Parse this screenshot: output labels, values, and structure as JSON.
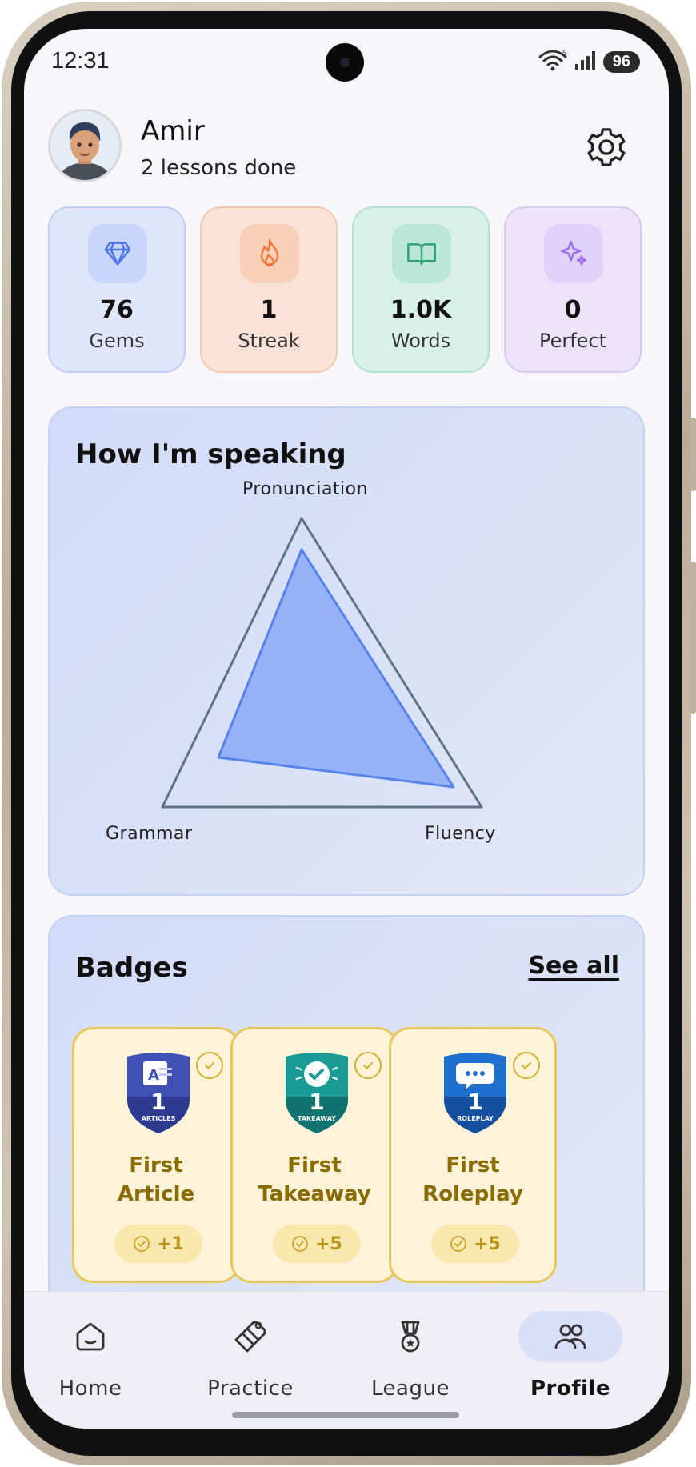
{
  "status_bar": {
    "time": "12:31",
    "battery": "96",
    "network_badge": "5"
  },
  "profile": {
    "name": "Amir",
    "subtitle": "2 lessons done"
  },
  "stats": [
    {
      "value": "76",
      "label": "Gems",
      "icon": "gem-icon"
    },
    {
      "value": "1",
      "label": "Streak",
      "icon": "flame-icon"
    },
    {
      "value": "1.0K",
      "label": "Words",
      "icon": "book-icon"
    },
    {
      "value": "0",
      "label": "Perfect",
      "icon": "sparkle-icon"
    }
  ],
  "speaking": {
    "title": "How I'm speaking",
    "axes": [
      "Pronunciation",
      "Grammar",
      "Fluency"
    ]
  },
  "badges": {
    "title": "Badges",
    "see_all": "See all",
    "items": [
      {
        "line1": "First",
        "line2": "Article",
        "count": "1",
        "caption": "ARTICLES",
        "points": "+1",
        "color": "#3f51b5"
      },
      {
        "line1": "First",
        "line2": "Takeaway",
        "count": "1",
        "caption": "TAKEAWAY",
        "points": "+5",
        "color": "#1a9b96"
      },
      {
        "line1": "First",
        "line2": "Roleplay",
        "count": "1",
        "caption": "ROLEPLAY",
        "points": "+5",
        "color": "#1f6fcf"
      }
    ]
  },
  "nav": [
    {
      "label": "Home",
      "icon": "home-icon"
    },
    {
      "label": "Practice",
      "icon": "practice-icon"
    },
    {
      "label": "League",
      "icon": "medal-icon"
    },
    {
      "label": "Profile",
      "icon": "people-icon",
      "active": true
    }
  ],
  "colors": {
    "accent": "#5b8cf0",
    "gold": "#e9c85a",
    "background": "#f6f6fb"
  }
}
